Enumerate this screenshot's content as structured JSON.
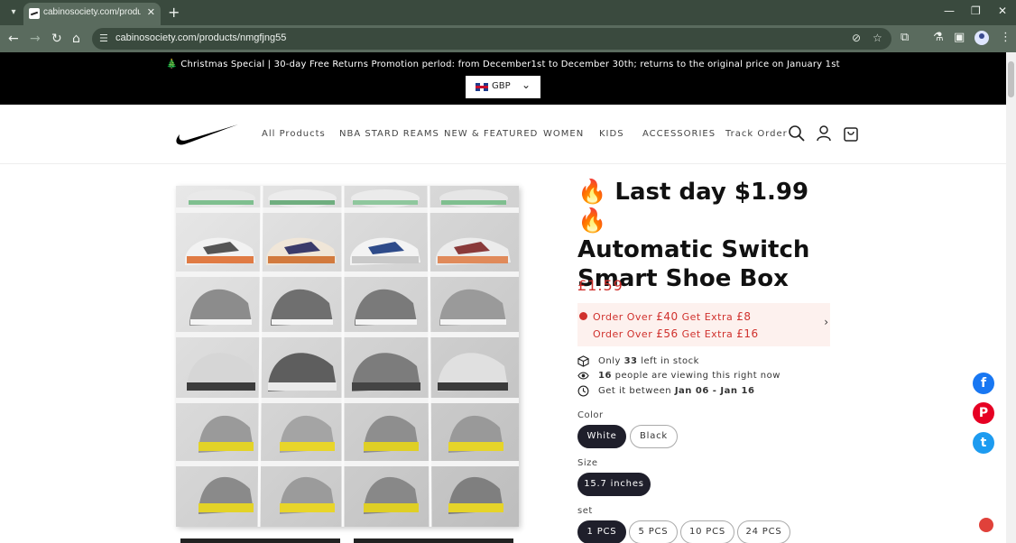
{
  "browser": {
    "tab_title": "cabinosociety.com/products/nm",
    "new_tab_label": "+",
    "url": "cabinosociety.com/products/nmgfjng55"
  },
  "promo": {
    "text": "🎄 Christmas Special | 30-day Free Returns Promotion perlod: from December1st to December 30th; returns to the original price on January 1st",
    "currency": "GBP"
  },
  "nav": {
    "items": [
      "All Products",
      "NBA STARD REAMS",
      "NEW & FEATURED",
      "WOMEN",
      "KIDS",
      "ACCESSORIES",
      "Track Order"
    ]
  },
  "product": {
    "title_line1": "🔥 Last day $1.99 🔥",
    "title_line2": "Automatic Switch",
    "title_line3": "Smart Shoe Box",
    "price": "£1.59",
    "offers": [
      {
        "prefix": "Order Over ",
        "amount": "£40",
        "mid": " Get Extra ",
        "extra": "£8"
      },
      {
        "prefix": "Order Over ",
        "amount": "£56",
        "mid": " Get Extra ",
        "extra": "£16"
      }
    ],
    "stock": {
      "before": "Only ",
      "count": "33",
      "after": " left in stock"
    },
    "viewers": {
      "count": "16",
      "after": " people are viewing this right now"
    },
    "delivery": {
      "before": "Get it between ",
      "range": "Jan 06 - Jan 16"
    },
    "color_label": "Color",
    "colors": [
      "White",
      "Black"
    ],
    "size_label": "Size",
    "sizes": [
      "15.7 inches"
    ],
    "set_label": "set",
    "sets": [
      "1 PCS",
      "5 PCS",
      "10 PCS",
      "24 PCS"
    ]
  },
  "social": {
    "facebook": "f",
    "pinterest": "P",
    "twitter": "t"
  },
  "colors": {
    "accent_red": "#d0312d",
    "selected_option": "#1f1f2b",
    "facebook": "#1877f2",
    "pinterest": "#e60023",
    "twitter": "#1d9bf0"
  }
}
